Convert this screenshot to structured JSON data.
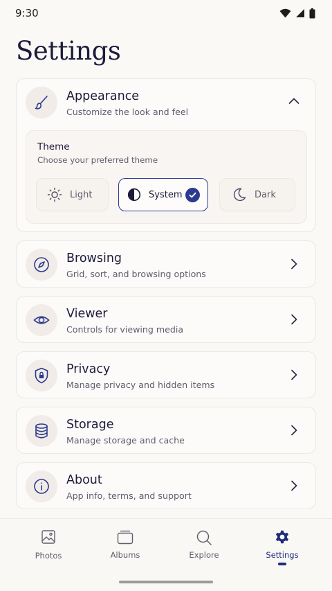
{
  "status_bar": {
    "time": "9:30"
  },
  "page": {
    "title": "Settings"
  },
  "appearance": {
    "title": "Appearance",
    "subtitle": "Customize the look and feel",
    "icon": "paintbrush-icon",
    "expanded": true,
    "theme": {
      "title": "Theme",
      "subtitle": "Choose your preferred theme",
      "options": [
        {
          "label": "Light",
          "icon": "sun-icon"
        },
        {
          "label": "System",
          "icon": "contrast-icon"
        },
        {
          "label": "Dark",
          "icon": "moon-icon"
        }
      ],
      "selected": "System"
    }
  },
  "sections": [
    {
      "title": "Browsing",
      "subtitle": "Grid, sort, and browsing options",
      "icon": "compass-icon"
    },
    {
      "title": "Viewer",
      "subtitle": "Controls for viewing media",
      "icon": "eye-icon"
    },
    {
      "title": "Privacy",
      "subtitle": "Manage privacy and hidden items",
      "icon": "shield-lock-icon"
    },
    {
      "title": "Storage",
      "subtitle": "Manage storage and cache",
      "icon": "database-icon"
    },
    {
      "title": "About",
      "subtitle": "App info, terms, and support",
      "icon": "info-icon"
    }
  ],
  "bottom_nav": {
    "items": [
      {
        "label": "Photos",
        "icon": "image-icon"
      },
      {
        "label": "Albums",
        "icon": "album-icon"
      },
      {
        "label": "Explore",
        "icon": "search-icon"
      },
      {
        "label": "Settings",
        "icon": "gear-icon"
      }
    ],
    "active": "Settings"
  },
  "colors": {
    "accent": "#2c3a8f",
    "background": "#fbf9f6",
    "text_primary": "#1c1b3a",
    "text_secondary": "#5f5d6e"
  }
}
